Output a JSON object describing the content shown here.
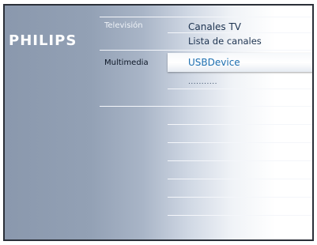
{
  "brand": {
    "logo": "PHILIPS"
  },
  "menu": {
    "categories": [
      {
        "label": "Televisión",
        "selected": false
      },
      {
        "label": "Multimedia",
        "selected": true
      }
    ],
    "television_items": [
      {
        "label": "Canales TV"
      },
      {
        "label": "Lista de canales"
      }
    ],
    "multimedia_items": [
      {
        "label": "USBDevice",
        "selected": true
      },
      {
        "label": "..........."
      }
    ]
  },
  "colors": {
    "selected_text": "#1d6fb0",
    "item_text": "#1d3350",
    "brand_text": "#ffffff"
  }
}
